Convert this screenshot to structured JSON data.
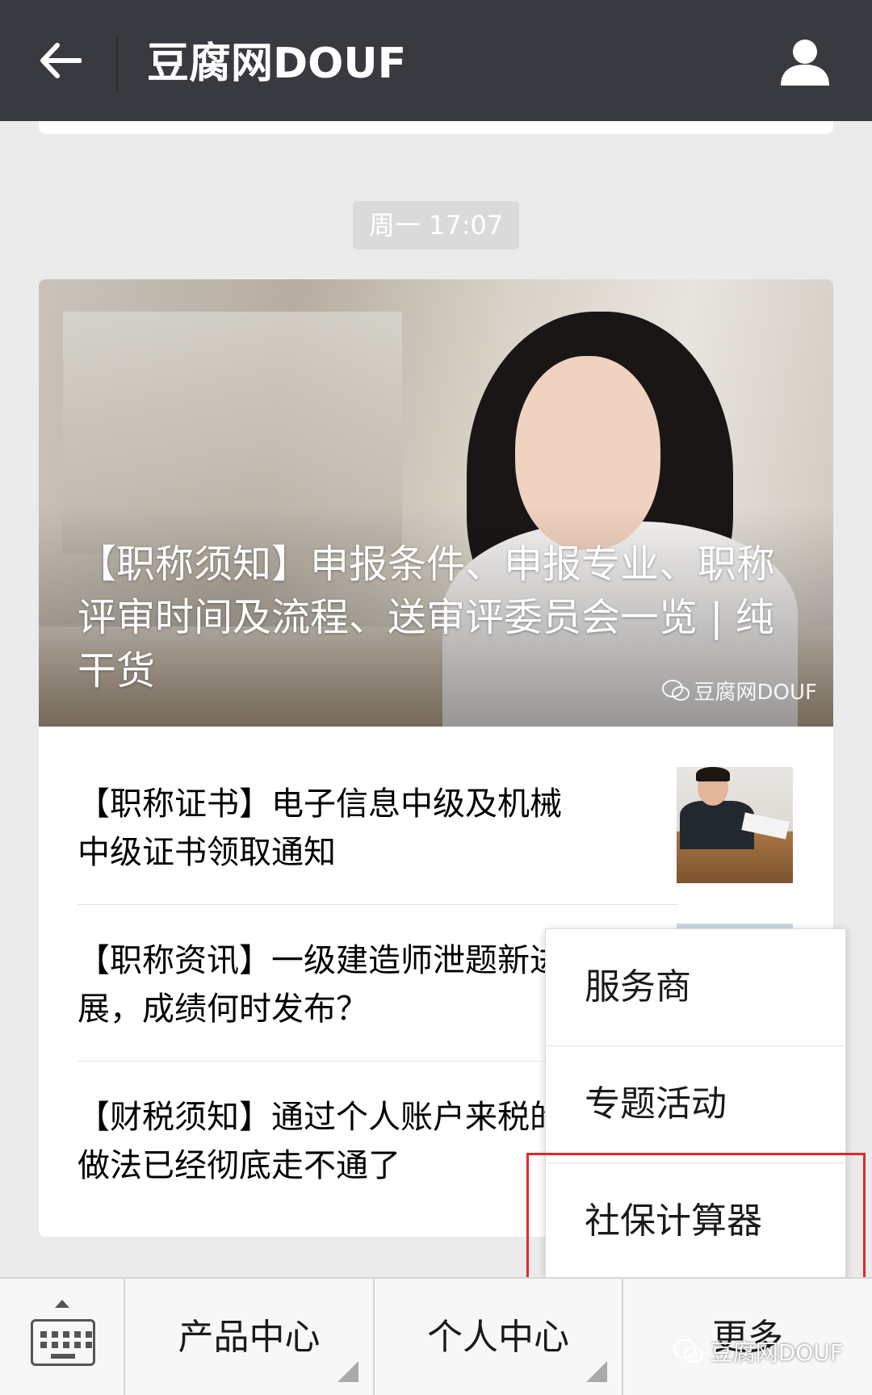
{
  "header": {
    "title": "豆腐网DOUF",
    "icons": {
      "back": "back-arrow-icon",
      "profile": "person-icon"
    }
  },
  "message": {
    "timestamp": "周一 17:07"
  },
  "article_card": {
    "hero_title": "【职称须知】申报条件、申报专业、职称评审时间及流程、送审评委员会一览 | 纯干货",
    "hero_watermark": "豆腐网DOUF",
    "items": [
      {
        "text": "【职称证书】电子信息中级及机械中级证书领取通知"
      },
      {
        "text": "【职称资讯】一级建造师泄题新进展，成绩何时发布？"
      },
      {
        "text": "【财税须知】通过个人账户来税的做法已经彻底走不通了"
      }
    ]
  },
  "popup_menu": {
    "items": [
      {
        "label": "服务商"
      },
      {
        "label": "专题活动"
      },
      {
        "label": "社保计算器"
      }
    ],
    "highlighted_item": "社保计算器",
    "highlight_color": "#e5262b"
  },
  "bottom_nav": {
    "keyboard_icon": "keyboard-icon",
    "items": [
      {
        "label": "产品中心"
      },
      {
        "label": "个人中心"
      },
      {
        "label": "更多"
      }
    ]
  },
  "watermark": "豆腐网DOUF",
  "colors": {
    "topbar": "#393a3f",
    "background": "#ebebeb",
    "card": "#ffffff"
  }
}
